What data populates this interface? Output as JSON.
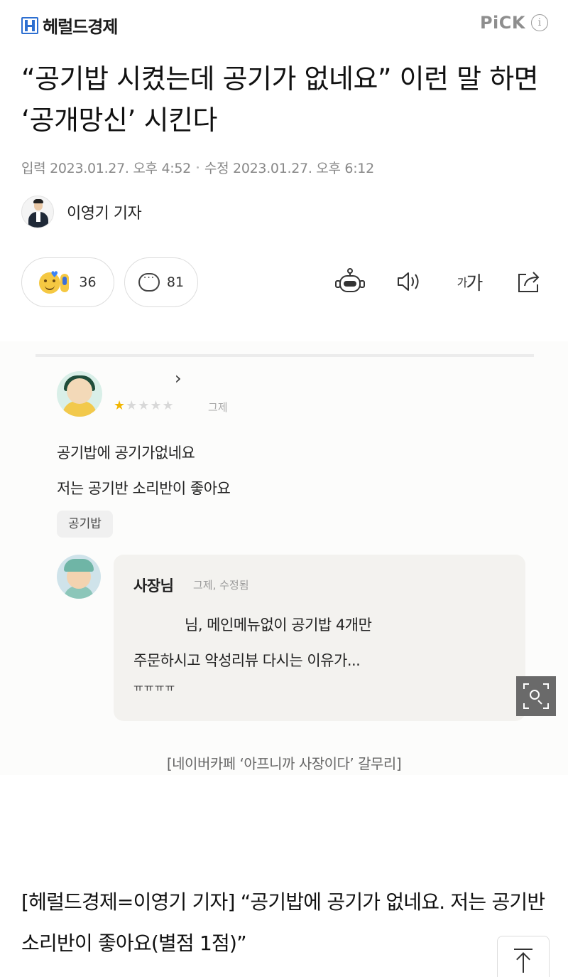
{
  "header": {
    "logo_text": "헤럴드경제",
    "pick_label": "PiCK",
    "info_icon": "i"
  },
  "article": {
    "headline": "“공기밥 시켰는데 공기가 없네요” 이런 말 하면 ‘공개망신’ 시킨다",
    "input_date": "입력 2023.01.27. 오후 4:52",
    "modified_date": "수정 2023.01.27. 오후 6:12",
    "reporter": "이영기 기자"
  },
  "reactions": {
    "reaction_count": "36",
    "comment_count": "81",
    "font_size_label_small": "가",
    "font_size_label_large": "가"
  },
  "figure": {
    "chevron": "›",
    "star_rating": 1,
    "stars_on": "★",
    "stars_off": "★★★★",
    "review_date": "그제",
    "review_line1": "공기밥에 공기가없네요",
    "review_line2": "저는 공기반 소리반이 좋아요",
    "tag": "공기밥",
    "owner_name": "사장님",
    "owner_meta": "그제, 수정됨",
    "owner_reply_line1": "님, 메인메뉴없이 공기밥 4개만",
    "owner_reply_line2": "주문하시고 악성리뷰 다시는 이유가...",
    "owner_reply_line3": "ㅠㅠㅠㅠ",
    "caption": "[네이버카페 ‘아프니까 사장이다’ 갈무리]"
  },
  "body": {
    "paragraph": "[헤럴드경제=이영기 기자] “공기밥에 공기가 없네요. 저는 공기반 소리반이 좋아요(별점 1점)”"
  },
  "icons": {
    "robot": "robot-icon",
    "speaker": "speaker-icon",
    "share": "share-icon",
    "comment": "comment-icon",
    "zoom": "zoom-icon",
    "top": "arrow-up-icon"
  }
}
